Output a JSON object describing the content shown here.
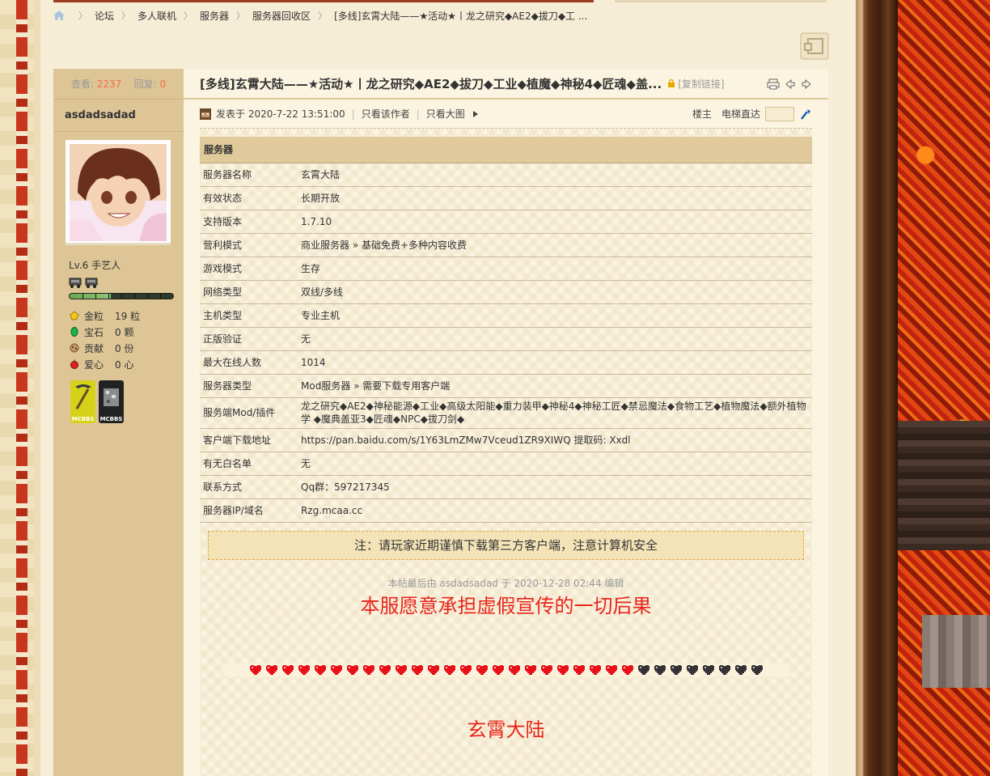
{
  "breadcrumb": {
    "items": [
      "论坛",
      "多人联机",
      "服务器",
      "服务器回收区",
      "[多线]玄霄大陆——★活动★丨龙之研究◆AE2◆拔刀◆工 ..."
    ]
  },
  "sidebar": {
    "views_label": "查看:",
    "views_value": "2237",
    "replies_label": "回复:",
    "replies_value": "0",
    "username": "asdadsadad",
    "level": "Lv.6 手艺人",
    "progress": 0.4,
    "credits": [
      {
        "icon": "gold-nugget-icon",
        "label": "金粒",
        "value": "19 粒"
      },
      {
        "icon": "emerald-icon",
        "label": "宝石",
        "value": "0 颗"
      },
      {
        "icon": "cookie-icon",
        "label": "贡献",
        "value": "0 份"
      },
      {
        "icon": "apple-icon",
        "label": "爱心",
        "value": "0 心"
      }
    ],
    "badges": [
      "MCBBS",
      "MCBBS"
    ]
  },
  "thread": {
    "title": "[多线]玄霄大陆——★活动★丨龙之研究◆AE2◆拔刀◆工业◆植魔◆神秘4◆匠魂◆盖...",
    "copy_link": "[复制链接]"
  },
  "post_meta": {
    "posted": "发表于 2020-7-22 13:51:00",
    "only_author": "只看该作者",
    "big_image": "只看大图",
    "floor": "楼主",
    "jump": "电梯直达"
  },
  "server_table": {
    "header": "服务器",
    "rows": [
      {
        "k": "服务器名称",
        "v": "玄霄大陆"
      },
      {
        "k": "有效状态",
        "v": "长期开放"
      },
      {
        "k": "支持版本",
        "v": "1.7.10"
      },
      {
        "k": "营利模式",
        "v": "商业服务器 » 基础免费+多种内容收费"
      },
      {
        "k": "游戏模式",
        "v": "生存"
      },
      {
        "k": "网络类型",
        "v": "双线/多线"
      },
      {
        "k": "主机类型",
        "v": "专业主机"
      },
      {
        "k": "正版验证",
        "v": "无"
      },
      {
        "k": "最大在线人数",
        "v": "1014"
      },
      {
        "k": "服务器类型",
        "v": "Mod服务器 » 需要下载专用客户端"
      },
      {
        "k": "服务端Mod/插件",
        "v": "龙之研究◆AE2◆神秘能源◆工业◆高级太阳能◆重力装甲◆神秘4◆神秘工匠◆禁忌魔法◆食物工艺◆植物魔法◆额外植物学 ◆魔典盖亚3◆匠魂◆NPC◆拔刀剑◆"
      },
      {
        "k": "客户端下载地址",
        "v": "https://pan.baidu.com/s/1Y63LmZMw7Vceud1ZR9XIWQ 提取码: Xxdl"
      },
      {
        "k": "有无白名单",
        "v": "无"
      },
      {
        "k": "联系方式",
        "v": "Qq群：597217345"
      },
      {
        "k": "服务器IP/域名",
        "v": "Rzg.mcaa.cc"
      }
    ]
  },
  "notice": "注：请玩家近期谨慎下载第三方客户端，注意计算机安全",
  "edited": "本帖最后由 asdadsadad 于 2020-12-28 02:44 编辑",
  "slogan": "本服愿意承担虚假宣传的一切后果",
  "hearts": {
    "full": 24,
    "empty": 8,
    "full_color": "#e8111b",
    "empty_color": "#333333"
  },
  "server_name": "玄霄大陆",
  "colors": {
    "accent": "#f26c4f",
    "red_text": "#e8251b",
    "sidebar_bg": "#ddc596"
  }
}
